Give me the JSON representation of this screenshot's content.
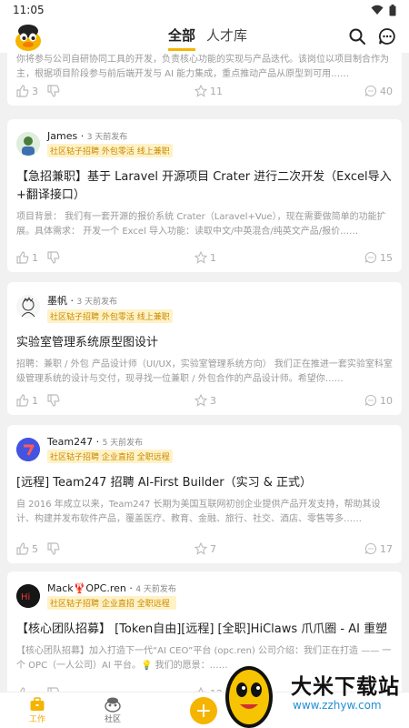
{
  "status": {
    "time": "11:05"
  },
  "header": {
    "tabs": [
      {
        "label": "全部",
        "active": true
      },
      {
        "label": "人才库",
        "active": false
      }
    ]
  },
  "posts": [
    {
      "id": "p0",
      "summary": "你将参与公司自研协同工具的开发，负责核心功能的实现与产品迭代。该岗位以项目制合作为主，根据项目阶段参与前后端开发与 AI 能力集成，重点推动产品从原型到可用……",
      "likes": "3",
      "stars": "11",
      "comments": "40"
    },
    {
      "id": "p1",
      "author": "James",
      "time": "3 天前发布",
      "tags": "社区轱子招聘 外包零活 线上兼职",
      "title": "【急招兼职】基于 Laravel 开源项目 Crater 进行二次开发（Excel导入+翻译接口）",
      "summary": "项目背景：    我们有一套开源的报价系统 Crater（Laravel+Vue），现在需要做简单的功能扩展。具体需求：   开发一个 Excel 导入功能：读取中文/中英混合/纯英文产品/报价……",
      "likes": "1",
      "stars": "1",
      "comments": "15"
    },
    {
      "id": "p2",
      "author": "墨帆",
      "time": "3 天前发布",
      "tags": "社区轱子招聘 外包零活 线上兼职",
      "title": "实验室管理系统原型图设计",
      "summary": "招聘：兼职 / 外包 产品设计师（UI/UX，实验室管理系统方向） 我们正在推进一套实验室科室级管理系统的设计与交付，现寻找一位兼职 / 外包合作的产品设计师。希望你……",
      "likes": "1",
      "stars": "3",
      "comments": "10"
    },
    {
      "id": "p3",
      "author": "Team247",
      "time": "5 天前发布",
      "tags": "社区轱子招聘 企业直招 全职远程",
      "title": "[远程] Team247 招聘 AI-First Builder（实习 & 正式）",
      "summary": "自 2016 年成立以来，Team247 长期为美国互联网初创企业提供产品开发支持，帮助其设计、构建并发布软件产品，覆盖医疗、教育、金融、旅行、社交、酒店、零售等多……",
      "likes": "5",
      "stars": "7",
      "comments": "17"
    },
    {
      "id": "p4",
      "author": "Mack🦞OPC.ren",
      "time": "4 天前发布",
      "tags": "社区轱子招聘 企业直招 全职远程",
      "title": "【核心团队招募】 [Token自由][远程] [全职]HiClaws 爪爪圈 - AI 重塑",
      "summary": "【核心团队招募】加入打造下一代“AI CEO”平台 (opc.ren) 公司介绍：我们正在打造 —— 一个 OPC（一人公司）AI 平台。💡 我们的愿景：……",
      "likes": "",
      "stars": "12",
      "comments": ""
    }
  ],
  "bottom_nav": {
    "work": "工作",
    "community": "社区",
    "add": "+"
  },
  "watermark": {
    "text": "大米下载站",
    "url": "www.zzhyw.com"
  },
  "colors": {
    "accent": "#f5b400",
    "tag_text": "#c98a00",
    "tag_bg": "#fff2c7"
  }
}
